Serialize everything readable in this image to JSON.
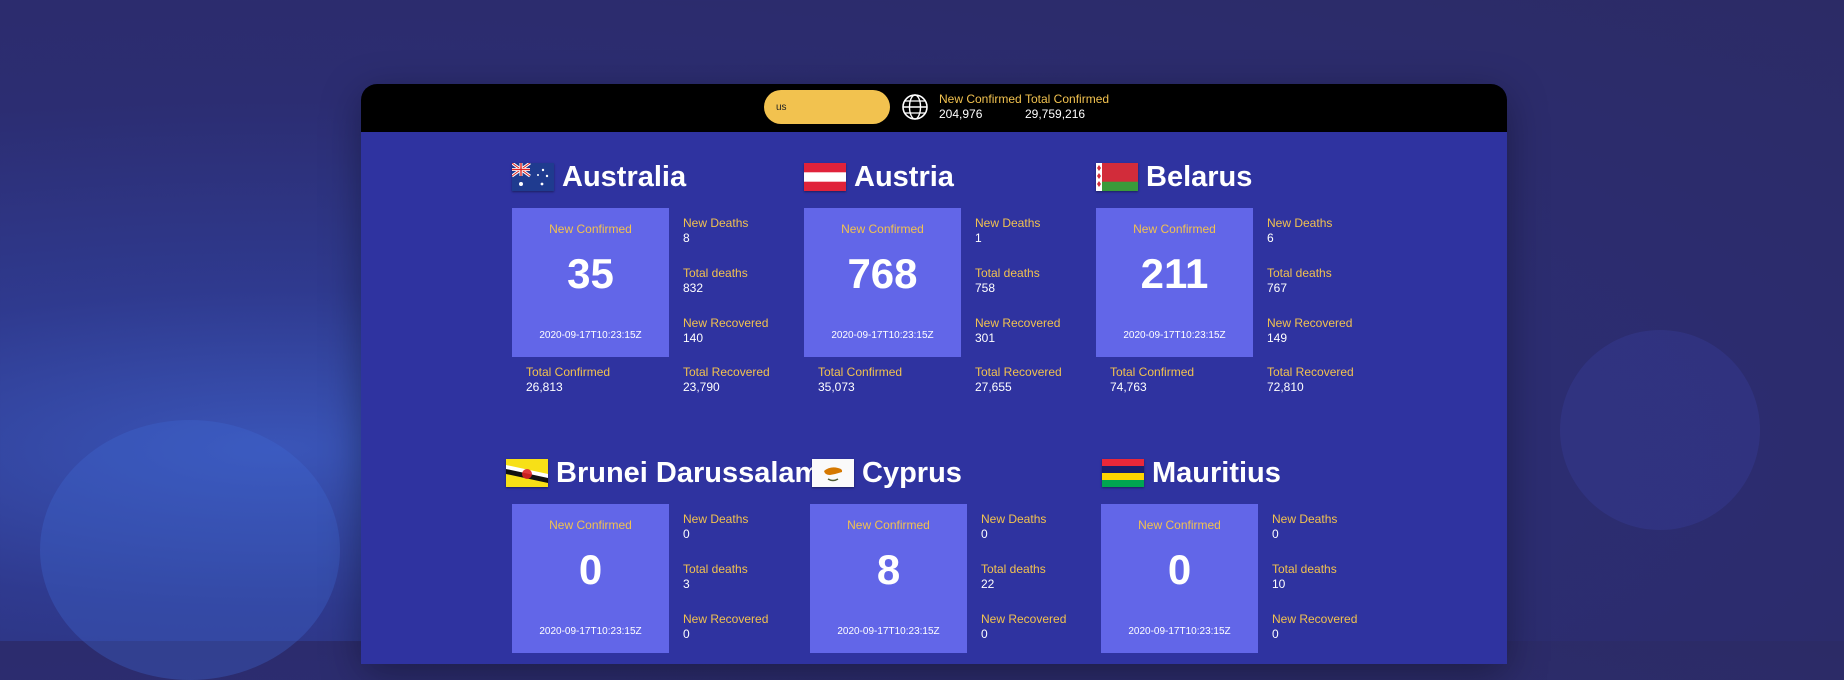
{
  "header": {
    "search_value": "us",
    "new_confirmed_label": "New Confirmed",
    "new_confirmed_value": "204,976",
    "total_confirmed_label": "Total Confirmed",
    "total_confirmed_value": "29,759,216",
    "globe_icon": "globe-icon"
  },
  "labels": {
    "new_confirmed": "New Confirmed",
    "new_deaths": "New Deaths",
    "total_deaths": "Total deaths",
    "new_recovered": "New Recovered",
    "total_confirmed": "Total Confirmed",
    "total_recovered": "Total Recovered"
  },
  "countries": [
    {
      "name": "Australia",
      "new_confirmed": "35",
      "date": "2020-09-17T10:23:15Z",
      "new_deaths": "8",
      "total_deaths": "832",
      "new_recovered": "140",
      "total_confirmed": "26,813",
      "total_recovered": "23,790"
    },
    {
      "name": "Austria",
      "new_confirmed": "768",
      "date": "2020-09-17T10:23:15Z",
      "new_deaths": "1",
      "total_deaths": "758",
      "new_recovered": "301",
      "total_confirmed": "35,073",
      "total_recovered": "27,655"
    },
    {
      "name": "Belarus",
      "new_confirmed": "211",
      "date": "2020-09-17T10:23:15Z",
      "new_deaths": "6",
      "total_deaths": "767",
      "new_recovered": "149",
      "total_confirmed": "74,763",
      "total_recovered": "72,810"
    },
    {
      "name": "Brunei Darussalam",
      "new_confirmed": "0",
      "date": "2020-09-17T10:23:15Z",
      "new_deaths": "0",
      "total_deaths": "3",
      "new_recovered": "0"
    },
    {
      "name": "Cyprus",
      "new_confirmed": "8",
      "date": "2020-09-17T10:23:15Z",
      "new_deaths": "0",
      "total_deaths": "22",
      "new_recovered": "0"
    },
    {
      "name": "Mauritius",
      "new_confirmed": "0",
      "date": "2020-09-17T10:23:15Z",
      "new_deaths": "0",
      "total_deaths": "10",
      "new_recovered": "0"
    }
  ],
  "colors": {
    "accent": "#f2c24f",
    "card": "#2f33a0",
    "box": "#6266e8"
  }
}
